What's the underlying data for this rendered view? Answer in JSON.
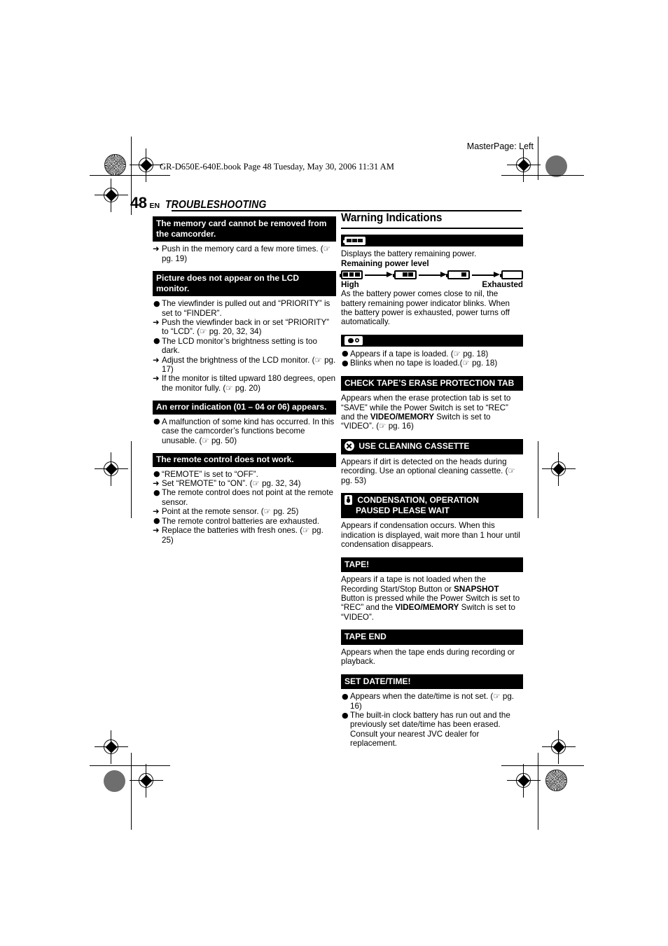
{
  "page": {
    "masterpage_note": "MasterPage: Left",
    "book_line": "GR-D650E-640E.book  Page 48  Tuesday, May 30, 2006  11:31 AM",
    "number": "48",
    "language": "EN",
    "title": "TROUBLESHOOTING"
  },
  "pgref_glyph": "☞",
  "markers": {
    "bullet": "●",
    "arrow": "➜",
    "long_arrow": "⟶"
  },
  "left_column": {
    "sections": [
      {
        "heading": "The memory card cannot be removed from the camcorder.",
        "items": [
          {
            "marker": "arrow",
            "text": "Push in the memory card a few more times. (☞ pg. 19)"
          }
        ]
      },
      {
        "heading": "Picture does not appear on the LCD monitor.",
        "items": [
          {
            "marker": "dot",
            "text": "The viewfinder is pulled out and “PRIORITY” is set to “FINDER”."
          },
          {
            "marker": "arrow",
            "text": "Push the viewfinder back in or set “PRIORITY” to “LCD”. (☞ pg. 20, 32, 34)"
          },
          {
            "marker": "dot",
            "text": "The LCD monitor’s brightness setting is too dark."
          },
          {
            "marker": "arrow",
            "text": "Adjust the brightness of the LCD monitor. (☞ pg. 17)"
          },
          {
            "marker": "arrow",
            "text": "If the monitor is tilted upward 180 degrees, open the monitor fully. (☞ pg. 20)"
          }
        ]
      },
      {
        "heading": "An error indication (01 – 04 or 06) appears.",
        "items": [
          {
            "marker": "dot",
            "text": "A malfunction of some kind has occurred. In this case the camcorder’s functions become unusable. (☞ pg. 50)"
          }
        ]
      },
      {
        "heading": "The remote control does not work.",
        "items": [
          {
            "marker": "dot",
            "text": "“REMOTE” is set to “OFF”."
          },
          {
            "marker": "arrow",
            "text": "Set “REMOTE” to “ON”. (☞ pg. 32, 34)"
          },
          {
            "marker": "dot",
            "text": "The remote control does not point at the remote sensor."
          },
          {
            "marker": "arrow",
            "text": "Point at the remote sensor. (☞ pg. 25)"
          },
          {
            "marker": "dot",
            "text": "The remote control batteries are exhausted."
          },
          {
            "marker": "arrow",
            "text": "Replace the batteries with fresh ones. (☞ pg. 25)"
          }
        ]
      }
    ]
  },
  "right_column": {
    "section_title": "Warning Indications",
    "battery_block": {
      "banner_icon": "battery-full-icon",
      "intro": "Displays the battery remaining power.",
      "level_label": "Remaining power level",
      "levels": [
        {
          "name": "battery-level-3-icon",
          "segments": 3
        },
        {
          "name": "battery-level-2-icon",
          "segments": 2
        },
        {
          "name": "battery-level-1-icon",
          "segments": 1
        },
        {
          "name": "battery-level-0-icon",
          "segments": 0
        }
      ],
      "scale_high": "High",
      "scale_exhausted": "Exhausted",
      "body": "As the battery power comes close to nil, the battery remaining power indicator blinks. When the battery power is exhausted, power turns off automatically."
    },
    "tape_block": {
      "banner_icon": "tape-cassette-icon",
      "items": [
        {
          "marker": "dot",
          "text": "Appears if a tape is loaded. (☞ pg. 18)"
        },
        {
          "marker": "dot",
          "text": "Blinks when no tape is loaded.(☞ pg. 18)"
        }
      ]
    },
    "blocks": [
      {
        "icon": null,
        "heading": "CHECK TAPE’S ERASE PROTECTION TAB",
        "paragraph_runs": [
          {
            "t": "Appears when the erase protection tab is set to “SAVE” while the Power Switch is set to “REC” and the ",
            "b": false
          },
          {
            "t": "VIDEO/MEMORY",
            "b": true
          },
          {
            "t": " Switch is set to “VIDEO”. (☞ pg. 16)",
            "b": false
          }
        ]
      },
      {
        "icon": "circled-x-icon",
        "heading": "USE CLEANING CASSETTE",
        "paragraph_runs": [
          {
            "t": "Appears if dirt is detected on the heads during recording. Use an optional cleaning cassette. (☞ pg. 53)",
            "b": false
          }
        ]
      },
      {
        "icon": "condensation-droplet-icon",
        "heading": "CONDENSATION, OPERATION PAUSED PLEASE WAIT",
        "heading_line1": "CONDENSATION, OPERATION",
        "heading_line2": "PAUSED PLEASE WAIT",
        "paragraph_runs": [
          {
            "t": "Appears if condensation occurs. When this indication is displayed, wait more than 1 hour until condensation disappears.",
            "b": false
          }
        ]
      },
      {
        "icon": null,
        "heading": "TAPE!",
        "paragraph_runs": [
          {
            "t": "Appears if a tape is not loaded when the Recording Start/Stop Button or ",
            "b": false
          },
          {
            "t": "SNAPSHOT",
            "b": true
          },
          {
            "t": " Button is pressed while the Power Switch is set to “REC” and the ",
            "b": false
          },
          {
            "t": "VIDEO/MEMORY",
            "b": true
          },
          {
            "t": " Switch is set to “VIDEO”.",
            "b": false
          }
        ]
      },
      {
        "icon": null,
        "heading": "TAPE END",
        "paragraph_runs": [
          {
            "t": "Appears when the tape ends during recording or playback.",
            "b": false
          }
        ]
      }
    ],
    "date_block": {
      "heading": "SET DATE/TIME!",
      "items": [
        {
          "marker": "dot",
          "text": "Appears when the date/time is not set. (☞ pg. 16)"
        },
        {
          "marker": "dot",
          "text": "The built-in clock battery has run out and the previously set date/time has been erased. Consult your nearest JVC dealer for replacement."
        }
      ]
    }
  }
}
